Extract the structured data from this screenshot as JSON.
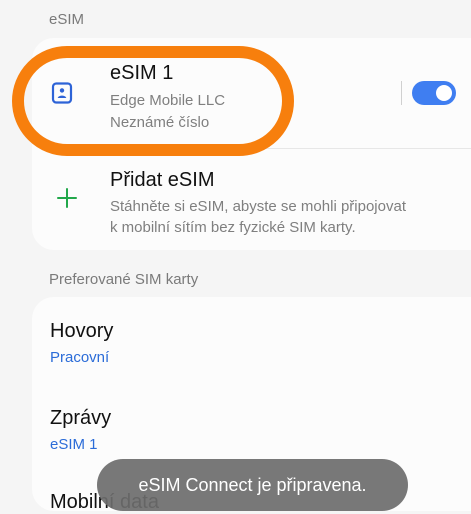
{
  "sections": {
    "esim_label": "eSIM",
    "preferred_label": "Preferované SIM karty"
  },
  "esim_card": {
    "title": "eSIM 1",
    "subtitle1": "Edge Mobile LLC",
    "subtitle2": "Neznámé číslo",
    "toggle_enabled": true
  },
  "add_esim": {
    "title": "Přidat eSIM",
    "desc_line1": "Stáhněte si eSIM, abyste se mohli připojovat",
    "desc_line2": "k mobilní sítím bez fyzické SIM karty."
  },
  "preferred": {
    "calls": {
      "title": "Hovory",
      "value": "Pracovní"
    },
    "messages": {
      "title": "Zprávy",
      "value": "eSIM 1"
    },
    "mobile_data": {
      "title": "Mobilní data"
    }
  },
  "toast": {
    "text": "eSIM Connect je připravena."
  },
  "colors": {
    "accent": "#3f7ef1",
    "highlight": "#f77f0d",
    "plus": "#22a84b",
    "blue_text": "#2b6cd8"
  },
  "icons": {
    "esim": "sim-card-icon",
    "add": "plus-icon"
  }
}
